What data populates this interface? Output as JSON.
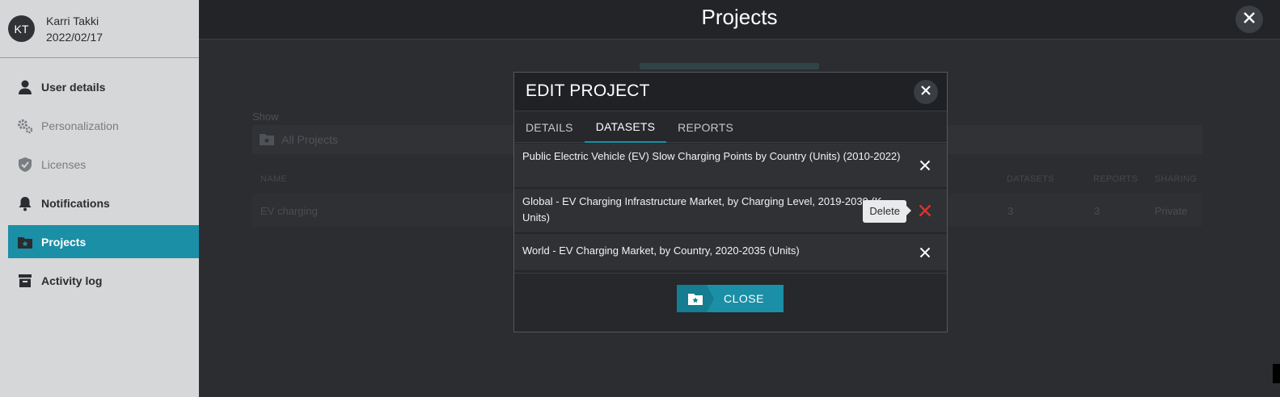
{
  "user": {
    "initials": "KT",
    "name": "Karri Takki",
    "date": "2022/02/17"
  },
  "sidebar": {
    "items": [
      {
        "label": "User details",
        "icon": "user-icon"
      },
      {
        "label": "Personalization",
        "icon": "gears-icon"
      },
      {
        "label": "Licenses",
        "icon": "shield-check-icon"
      },
      {
        "label": "Notifications",
        "icon": "bell-icon"
      },
      {
        "label": "Projects",
        "icon": "folder-star-icon"
      },
      {
        "label": "Activity log",
        "icon": "archive-icon"
      }
    ],
    "active": "Projects"
  },
  "header": {
    "title": "Projects"
  },
  "background": {
    "show_label": "Show",
    "filter_value": "All Projects",
    "columns": [
      "NAME",
      "DATASETS",
      "REPORTS",
      "SHARING"
    ],
    "row": {
      "name": "EV charging",
      "datasets": "3",
      "reports": "3",
      "sharing": "Private"
    }
  },
  "modal": {
    "title": "EDIT PROJECT",
    "tabs": [
      "DETAILS",
      "DATASETS",
      "REPORTS"
    ],
    "active_tab": "DATASETS",
    "datasets": [
      "Public Electric Vehicle (EV) Slow Charging Points by Country (Units) (2010-2022)",
      "Global - EV Charging Infrastructure Market, by Charging Level, 2019-2030 (K Units)",
      "World - EV Charging Market, by Country, 2020-2035 (Units)"
    ],
    "tooltip": "Delete",
    "close_label": "CLOSE"
  },
  "colors": {
    "accent": "#1a8fa6",
    "danger": "#e0312f"
  }
}
